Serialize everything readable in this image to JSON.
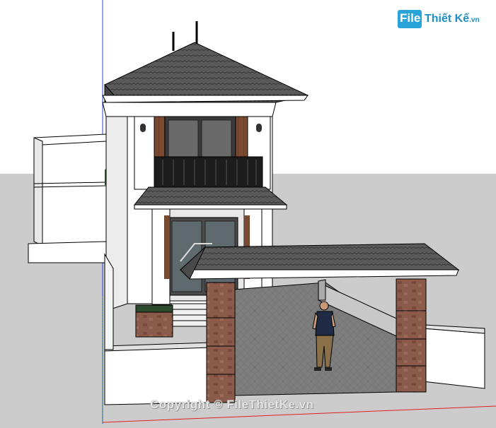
{
  "app": {
    "title": ""
  },
  "viewport": {
    "background": "#ffffff",
    "ground_color": "#cccccc",
    "axis_red": "#e02020",
    "axis_blue": "#3040e0"
  },
  "logo": {
    "file": "File",
    "rest": "Thiết Kế",
    "suffix": ".vn",
    "accent": "#2aa3d9"
  },
  "watermark": {
    "text": "Copyright © FileThietKe.vn"
  },
  "scene": {
    "roof_color": "#5a5a5a",
    "brick_color": "#8a5a4a",
    "wood_color": "#7a4a30",
    "wall_color": "#ffffff",
    "pavement_color": "#7f7f7f",
    "grass_color": "#1f3a1f"
  }
}
